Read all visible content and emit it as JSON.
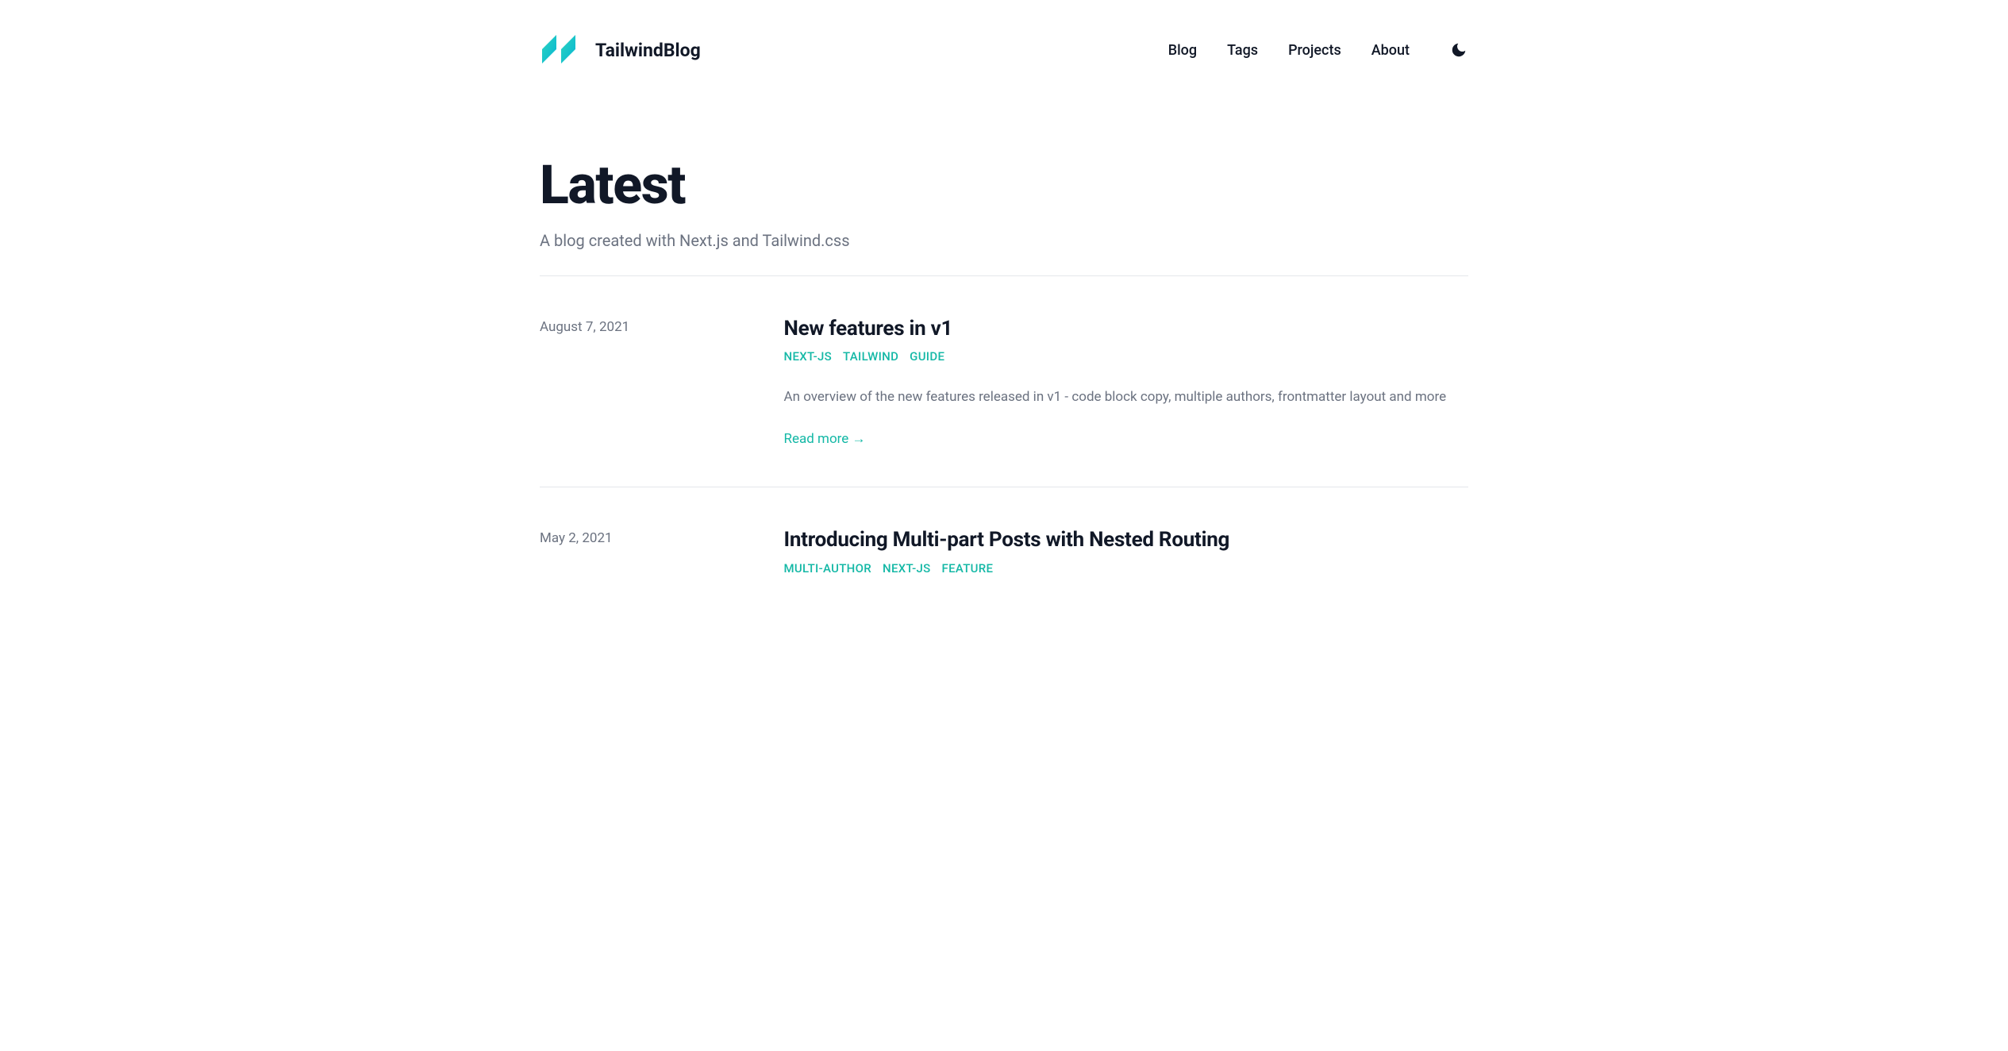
{
  "header": {
    "brand": "TailwindBlog",
    "nav": {
      "blog": "Blog",
      "tags": "Tags",
      "projects": "Projects",
      "about": "About"
    }
  },
  "hero": {
    "title": "Latest",
    "subtitle": "A blog created with Next.js and Tailwind.css"
  },
  "posts": [
    {
      "date": "August 7, 2021",
      "title": "New features in v1",
      "tags": [
        "NEXT-JS",
        "TAILWIND",
        "GUIDE"
      ],
      "excerpt": "An overview of the new features released in v1 - code block copy, multiple authors, frontmatter layout and more",
      "readmore": "Read more →"
    },
    {
      "date": "May 2, 2021",
      "title": "Introducing Multi-part Posts with Nested Routing",
      "tags": [
        "MULTI-AUTHOR",
        "NEXT-JS",
        "FEATURE"
      ],
      "excerpt": "",
      "readmore": ""
    }
  ],
  "colors": {
    "accent": "#14b8a6",
    "text": "#111827",
    "muted": "#6b7280",
    "border": "#e5e7eb"
  }
}
